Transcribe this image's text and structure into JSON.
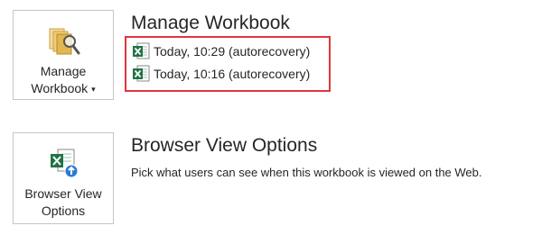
{
  "manage_workbook": {
    "button_line1": "Manage",
    "button_line2": "Workbook",
    "dropdown_caret": "▾",
    "title": "Manage Workbook",
    "icon": "folder-magnifier-icon",
    "versions": [
      {
        "label": "Today, 10:29 (autorecovery)",
        "icon": "excel-file-icon"
      },
      {
        "label": "Today, 10:16 (autorecovery)",
        "icon": "excel-file-icon"
      }
    ],
    "highlight_color": "#e0363d"
  },
  "browser_view_options": {
    "button_line1": "Browser View",
    "button_line2": "Options",
    "title": "Browser View Options",
    "description": "Pick what users can see when this workbook is viewed on the Web.",
    "icon": "excel-browser-view-icon"
  },
  "colors": {
    "excel_green": "#217346",
    "accent_blue": "#2b7bd3",
    "folder_gold": "#e3b74f"
  }
}
